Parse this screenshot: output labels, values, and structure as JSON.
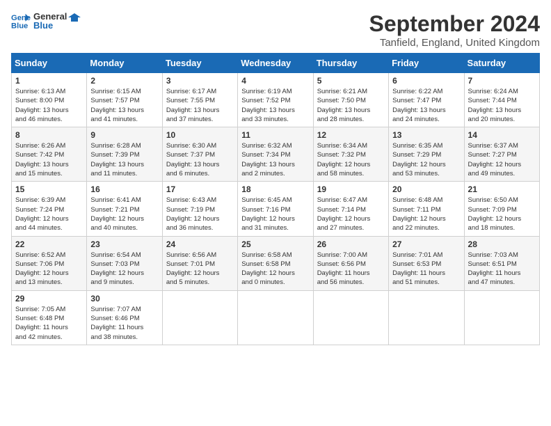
{
  "logo": {
    "line1": "General",
    "line2": "Blue"
  },
  "title": "September 2024",
  "location": "Tanfield, England, United Kingdom",
  "weekdays": [
    "Sunday",
    "Monday",
    "Tuesday",
    "Wednesday",
    "Thursday",
    "Friday",
    "Saturday"
  ],
  "weeks": [
    [
      {
        "day": "1",
        "info": "Sunrise: 6:13 AM\nSunset: 8:00 PM\nDaylight: 13 hours\nand 46 minutes."
      },
      {
        "day": "2",
        "info": "Sunrise: 6:15 AM\nSunset: 7:57 PM\nDaylight: 13 hours\nand 41 minutes."
      },
      {
        "day": "3",
        "info": "Sunrise: 6:17 AM\nSunset: 7:55 PM\nDaylight: 13 hours\nand 37 minutes."
      },
      {
        "day": "4",
        "info": "Sunrise: 6:19 AM\nSunset: 7:52 PM\nDaylight: 13 hours\nand 33 minutes."
      },
      {
        "day": "5",
        "info": "Sunrise: 6:21 AM\nSunset: 7:50 PM\nDaylight: 13 hours\nand 28 minutes."
      },
      {
        "day": "6",
        "info": "Sunrise: 6:22 AM\nSunset: 7:47 PM\nDaylight: 13 hours\nand 24 minutes."
      },
      {
        "day": "7",
        "info": "Sunrise: 6:24 AM\nSunset: 7:44 PM\nDaylight: 13 hours\nand 20 minutes."
      }
    ],
    [
      {
        "day": "8",
        "info": "Sunrise: 6:26 AM\nSunset: 7:42 PM\nDaylight: 13 hours\nand 15 minutes."
      },
      {
        "day": "9",
        "info": "Sunrise: 6:28 AM\nSunset: 7:39 PM\nDaylight: 13 hours\nand 11 minutes."
      },
      {
        "day": "10",
        "info": "Sunrise: 6:30 AM\nSunset: 7:37 PM\nDaylight: 13 hours\nand 6 minutes."
      },
      {
        "day": "11",
        "info": "Sunrise: 6:32 AM\nSunset: 7:34 PM\nDaylight: 13 hours\nand 2 minutes."
      },
      {
        "day": "12",
        "info": "Sunrise: 6:34 AM\nSunset: 7:32 PM\nDaylight: 12 hours\nand 58 minutes."
      },
      {
        "day": "13",
        "info": "Sunrise: 6:35 AM\nSunset: 7:29 PM\nDaylight: 12 hours\nand 53 minutes."
      },
      {
        "day": "14",
        "info": "Sunrise: 6:37 AM\nSunset: 7:27 PM\nDaylight: 12 hours\nand 49 minutes."
      }
    ],
    [
      {
        "day": "15",
        "info": "Sunrise: 6:39 AM\nSunset: 7:24 PM\nDaylight: 12 hours\nand 44 minutes."
      },
      {
        "day": "16",
        "info": "Sunrise: 6:41 AM\nSunset: 7:21 PM\nDaylight: 12 hours\nand 40 minutes."
      },
      {
        "day": "17",
        "info": "Sunrise: 6:43 AM\nSunset: 7:19 PM\nDaylight: 12 hours\nand 36 minutes."
      },
      {
        "day": "18",
        "info": "Sunrise: 6:45 AM\nSunset: 7:16 PM\nDaylight: 12 hours\nand 31 minutes."
      },
      {
        "day": "19",
        "info": "Sunrise: 6:47 AM\nSunset: 7:14 PM\nDaylight: 12 hours\nand 27 minutes."
      },
      {
        "day": "20",
        "info": "Sunrise: 6:48 AM\nSunset: 7:11 PM\nDaylight: 12 hours\nand 22 minutes."
      },
      {
        "day": "21",
        "info": "Sunrise: 6:50 AM\nSunset: 7:09 PM\nDaylight: 12 hours\nand 18 minutes."
      }
    ],
    [
      {
        "day": "22",
        "info": "Sunrise: 6:52 AM\nSunset: 7:06 PM\nDaylight: 12 hours\nand 13 minutes."
      },
      {
        "day": "23",
        "info": "Sunrise: 6:54 AM\nSunset: 7:03 PM\nDaylight: 12 hours\nand 9 minutes."
      },
      {
        "day": "24",
        "info": "Sunrise: 6:56 AM\nSunset: 7:01 PM\nDaylight: 12 hours\nand 5 minutes."
      },
      {
        "day": "25",
        "info": "Sunrise: 6:58 AM\nSunset: 6:58 PM\nDaylight: 12 hours\nand 0 minutes."
      },
      {
        "day": "26",
        "info": "Sunrise: 7:00 AM\nSunset: 6:56 PM\nDaylight: 11 hours\nand 56 minutes."
      },
      {
        "day": "27",
        "info": "Sunrise: 7:01 AM\nSunset: 6:53 PM\nDaylight: 11 hours\nand 51 minutes."
      },
      {
        "day": "28",
        "info": "Sunrise: 7:03 AM\nSunset: 6:51 PM\nDaylight: 11 hours\nand 47 minutes."
      }
    ],
    [
      {
        "day": "29",
        "info": "Sunrise: 7:05 AM\nSunset: 6:48 PM\nDaylight: 11 hours\nand 42 minutes."
      },
      {
        "day": "30",
        "info": "Sunrise: 7:07 AM\nSunset: 6:46 PM\nDaylight: 11 hours\nand 38 minutes."
      },
      null,
      null,
      null,
      null,
      null
    ]
  ]
}
